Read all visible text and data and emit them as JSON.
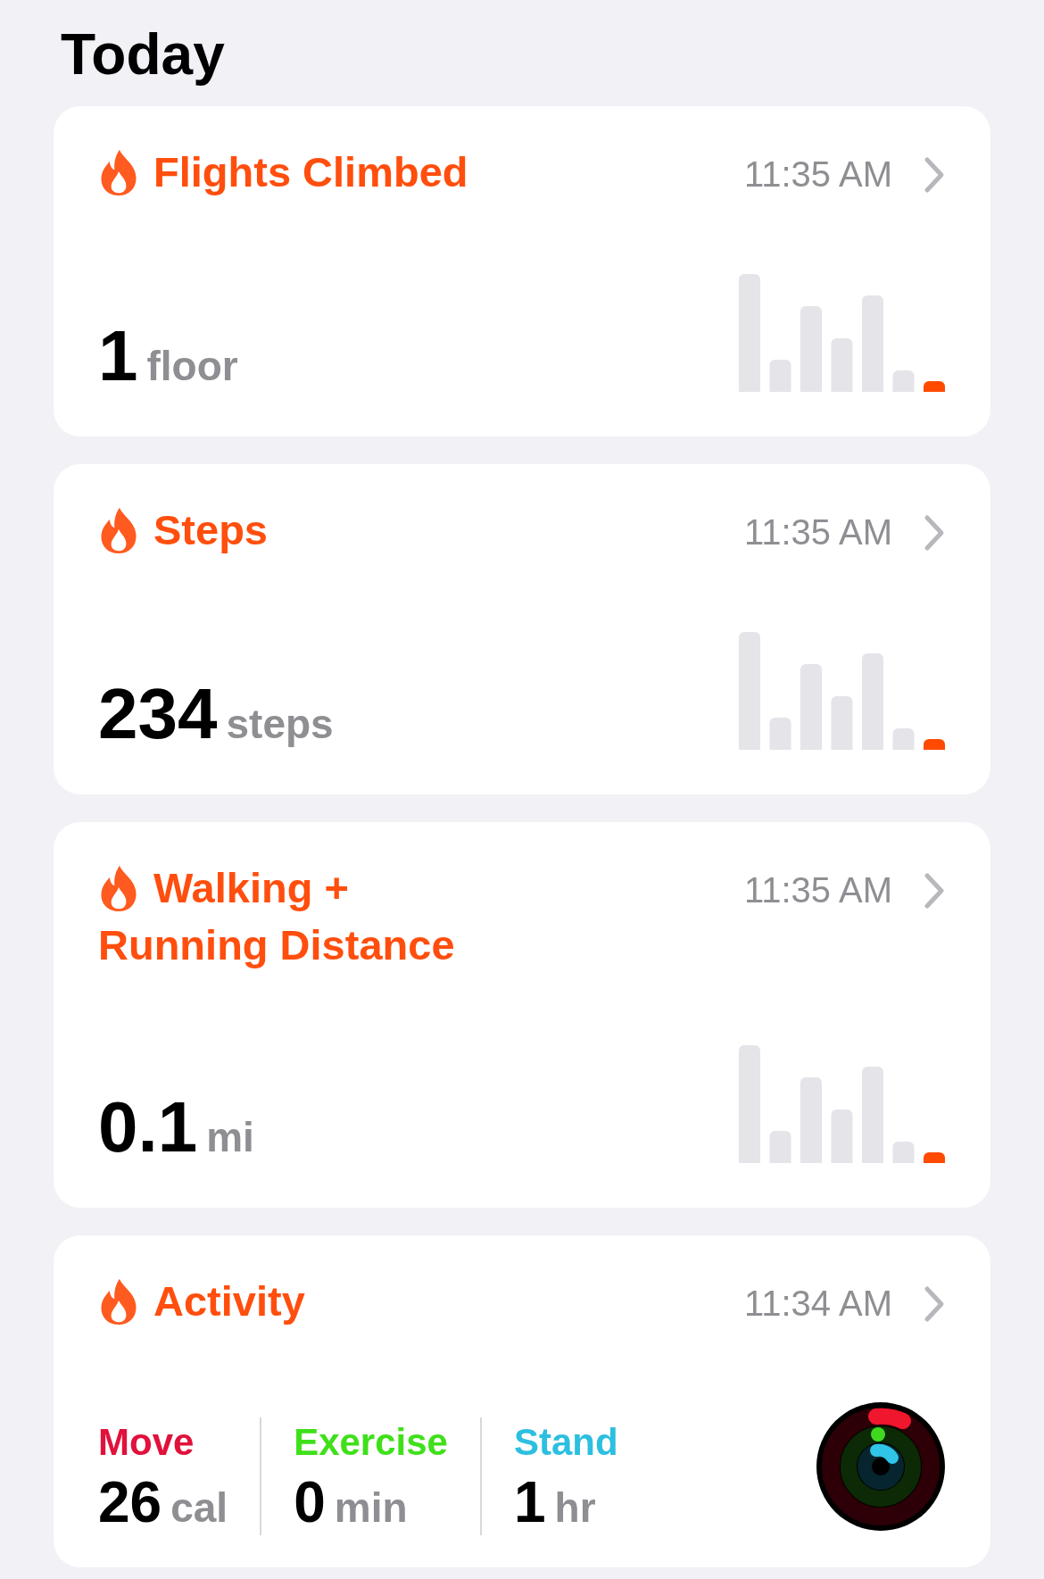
{
  "title": "Today",
  "cards": [
    {
      "kind": "metric",
      "title": "Flights Climbed",
      "time": "11:35 AM",
      "value": "1",
      "unit": "floor"
    },
    {
      "kind": "metric",
      "title": "Steps",
      "time": "11:35 AM",
      "value": "234",
      "unit": "steps"
    },
    {
      "kind": "metric",
      "title": "Walking +\nRunning Distance",
      "time": "11:35 AM",
      "value": "0.1",
      "unit": "mi"
    },
    {
      "kind": "activity",
      "title": "Activity",
      "time": "11:34 AM",
      "stats": [
        {
          "label": "Move",
          "value": "26",
          "unit": "cal",
          "color": "#e0123c"
        },
        {
          "label": "Exercise",
          "value": "0",
          "unit": "min",
          "color": "#3fe01a"
        },
        {
          "label": "Stand",
          "value": "1",
          "unit": "hr",
          "color": "#2cbfe0"
        }
      ]
    }
  ]
}
